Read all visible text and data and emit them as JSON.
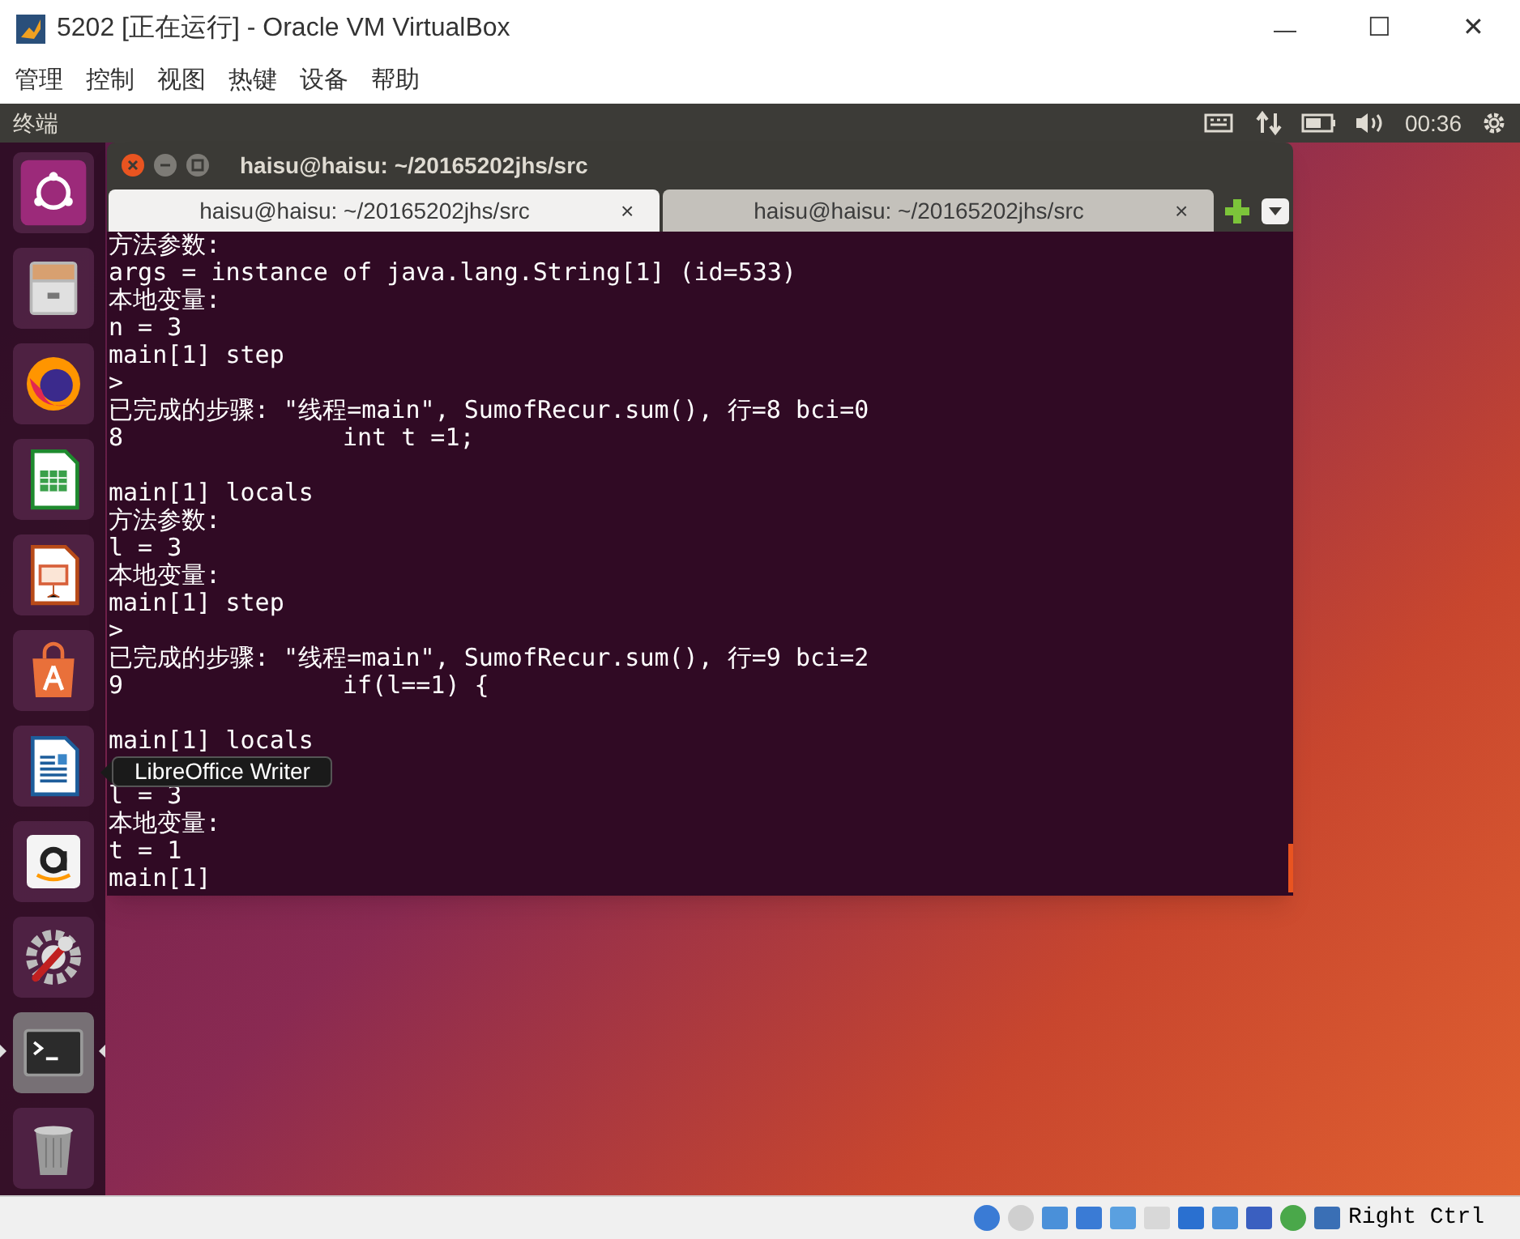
{
  "window": {
    "title": "5202 [正在运行] - Oracle VM VirtualBox",
    "min": "—",
    "max": "☐",
    "close": "✕"
  },
  "menu": [
    "管理",
    "控制",
    "视图",
    "热键",
    "设备",
    "帮助"
  ],
  "top_panel": {
    "app_name": "终端",
    "clock": "00:36"
  },
  "launcher": [
    {
      "kind": "ubuntu",
      "running": false
    },
    {
      "kind": "files",
      "running": false
    },
    {
      "kind": "firefox",
      "running": false
    },
    {
      "kind": "calc",
      "running": false
    },
    {
      "kind": "impress",
      "running": false
    },
    {
      "kind": "software",
      "running": false
    },
    {
      "kind": "writer",
      "running": false
    },
    {
      "kind": "amazon",
      "running": false
    },
    {
      "kind": "settings",
      "running": false
    },
    {
      "kind": "terminal",
      "running": true
    },
    {
      "kind": "trash",
      "running": false
    }
  ],
  "terminal": {
    "title": "haisu@haisu: ~/20165202jhs/src",
    "tabs": [
      {
        "label": "haisu@haisu: ~/20165202jhs/src",
        "close": "×",
        "selected": true
      },
      {
        "label": "haisu@haisu: ~/20165202jhs/src",
        "close": "×",
        "selected": false
      }
    ],
    "lines": [
      {
        "kind": "text",
        "text": "方法参数:"
      },
      {
        "kind": "text",
        "text": "args = instance of java.lang.String[1] (id=533)"
      },
      {
        "kind": "text",
        "text": "本地变量:"
      },
      {
        "kind": "text",
        "text": "n = 3"
      },
      {
        "kind": "text",
        "text": "main[1] step"
      },
      {
        "kind": "text",
        "text": ">"
      },
      {
        "kind": "text",
        "text": "已完成的步骤: \"线程=main\", SumofRecur.sum(), 行=8 bci=0"
      },
      {
        "kind": "text",
        "text": "8               int t =1;"
      },
      {
        "kind": "blank"
      },
      {
        "kind": "text",
        "text": "main[1] locals"
      },
      {
        "kind": "text",
        "text": "方法参数:"
      },
      {
        "kind": "text",
        "text": "l = 3"
      },
      {
        "kind": "text",
        "text": "本地变量:"
      },
      {
        "kind": "text",
        "text": "main[1] step"
      },
      {
        "kind": "text",
        "text": ">"
      },
      {
        "kind": "text",
        "text": "已完成的步骤: \"线程=main\", SumofRecur.sum(), 行=9 bci=2"
      },
      {
        "kind": "text",
        "text": "9               if(l==1) {"
      },
      {
        "kind": "blank"
      },
      {
        "kind": "text",
        "text": "main[1] locals"
      },
      {
        "kind": "blank"
      },
      {
        "kind": "text",
        "text": "l = 3"
      },
      {
        "kind": "text",
        "text": "本地变量:"
      },
      {
        "kind": "text",
        "text": "t = 1"
      },
      {
        "kind": "text",
        "text": "main[1]"
      }
    ]
  },
  "tooltip": "LibreOffice Writer",
  "status_bar": {
    "host_key": "Right Ctrl"
  }
}
